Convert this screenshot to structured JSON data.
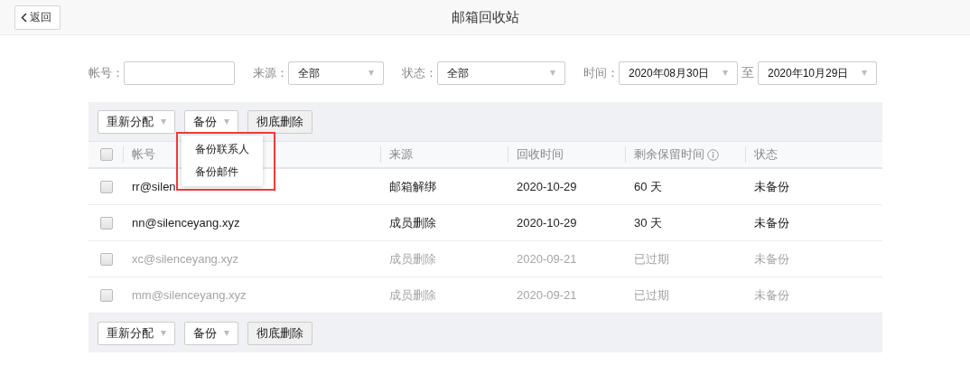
{
  "header": {
    "back": "返回",
    "title": "邮箱回收站"
  },
  "filters": {
    "account": {
      "label": "帐号："
    },
    "source": {
      "label": "来源：",
      "value": "全部"
    },
    "status": {
      "label": "状态：",
      "value": "全部"
    },
    "time": {
      "label": "时间：",
      "from": "2020年08月30日",
      "separator": "至",
      "to": "2020年10月29日"
    }
  },
  "toolbar": [
    {
      "label": "重新分配",
      "kind": "dropdown"
    },
    {
      "label": "备份",
      "kind": "dropdown"
    },
    {
      "label": "彻底删除",
      "kind": "plain"
    }
  ],
  "backup_menu": {
    "highlighted": true,
    "items": [
      "备份联系人",
      "备份邮件"
    ]
  },
  "table": {
    "select_all": {
      "checked": false
    },
    "columns": [
      "帐号",
      "来源",
      "回收时间",
      "剩余保留时间",
      "状态"
    ],
    "rows": [
      {
        "checked": false,
        "expired": false,
        "cells": [
          "rr@silen",
          "邮箱解绑",
          "2020-10-29",
          "60 天",
          "未备份"
        ]
      },
      {
        "checked": false,
        "expired": false,
        "cells": [
          "nn@silenceyang.xyz",
          "成员删除",
          "2020-10-29",
          "30 天",
          "未备份"
        ]
      },
      {
        "checked": false,
        "expired": true,
        "cells": [
          "xc@silenceyang.xyz",
          "成员删除",
          "2020-09-21",
          "已过期",
          "未备份"
        ]
      },
      {
        "checked": false,
        "expired": true,
        "cells": [
          "mm@silenceyang.xyz",
          "成员删除",
          "2020-09-21",
          "已过期",
          "未备份"
        ]
      }
    ]
  },
  "bottom_toolbar": [
    {
      "label": "重新分配",
      "kind": "dropdown"
    },
    {
      "label": "备份",
      "kind": "dropdown"
    },
    {
      "label": "彻底删除",
      "kind": "plain"
    }
  ]
}
